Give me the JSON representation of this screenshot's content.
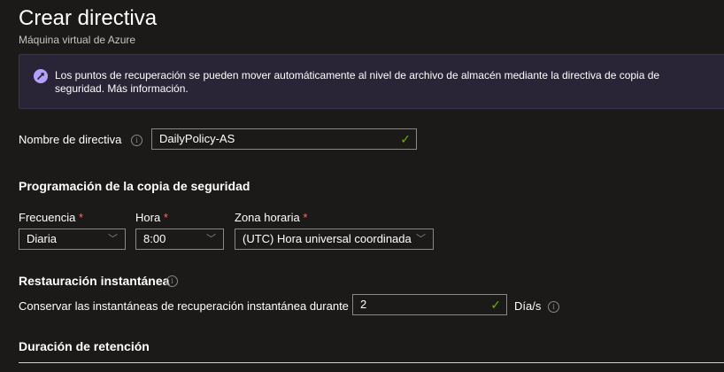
{
  "header": {
    "title": "Crear directiva",
    "subtitle": "Máquina virtual de Azure"
  },
  "banner": {
    "icon": "rocket-icon",
    "text": "Los puntos de recuperación se pueden mover automáticamente al nivel de archivo de almacén mediante la directiva de copia de seguridad. Más información."
  },
  "policy": {
    "name_label": "Nombre de directiva",
    "name_value": "DailyPolicy-AS"
  },
  "schedule": {
    "heading": "Programación de la copia de seguridad",
    "frequency_label": "Frecuencia",
    "frequency_value": "Diaria",
    "time_label": "Hora",
    "time_value": "8:00",
    "timezone_label": "Zona horaria",
    "timezone_value": "(UTC) Hora universal coordinada",
    "required_mark": "*"
  },
  "instant_restore": {
    "heading": "Restauración instantánea",
    "retain_label": "Conservar las instantáneas de recuperación instantánea durante",
    "retain_value": "2",
    "unit": "Día/s"
  },
  "retention": {
    "heading": "Duración de retención"
  },
  "colors": {
    "background": "#1b1a19",
    "banner_bg": "#2a2536",
    "success_check": "#6bb700",
    "required": "#ff6b6b"
  }
}
